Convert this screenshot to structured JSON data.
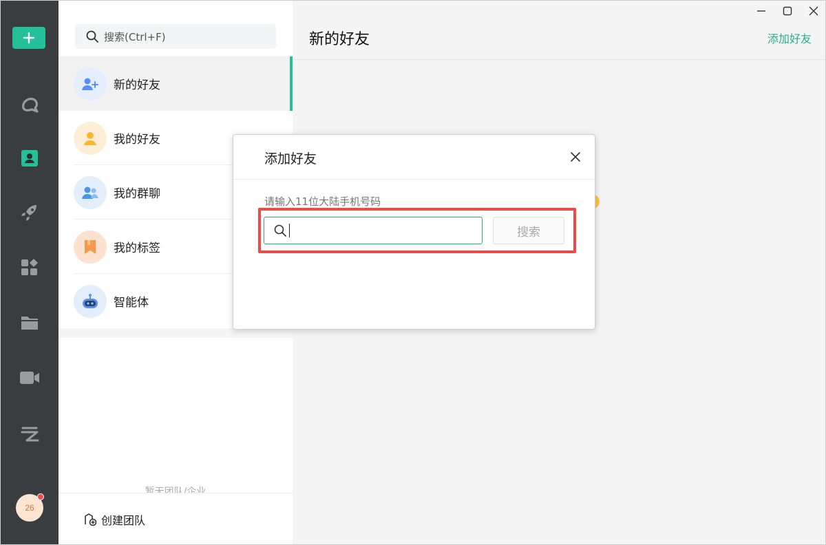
{
  "sidebar": {
    "items": [
      {
        "icon": "plus-icon"
      },
      {
        "icon": "app-logo-icon"
      },
      {
        "icon": "contacts-icon",
        "active": true
      },
      {
        "icon": "rocket-icon"
      },
      {
        "icon": "apps-grid-icon"
      },
      {
        "icon": "folder-icon"
      },
      {
        "icon": "video-camera-icon"
      },
      {
        "icon": "cloud-icon"
      }
    ],
    "avatar_text": "26"
  },
  "panel": {
    "search_placeholder": "搜索(Ctrl+F)",
    "items": [
      {
        "label": "新的好友",
        "icon": "add-friend-icon",
        "active": true
      },
      {
        "label": "我的好友",
        "icon": "friend-icon"
      },
      {
        "label": "我的群聊",
        "icon": "group-chat-icon"
      },
      {
        "label": "我的标签",
        "icon": "tag-icon"
      },
      {
        "label": "智能体",
        "icon": "robot-icon"
      }
    ],
    "empty_text": "暂无团队/企业",
    "create_team_label": "创建团队"
  },
  "main": {
    "title": "新的好友",
    "add_friend_link": "添加好友"
  },
  "dialog": {
    "title": "添加好友",
    "hint": "请输入11位大陆手机号码",
    "input_value": "",
    "search_button": "搜索"
  },
  "colors": {
    "accent": "#23c09a",
    "rail_bg": "#3a3d40",
    "highlight": "#ea4b4b"
  }
}
